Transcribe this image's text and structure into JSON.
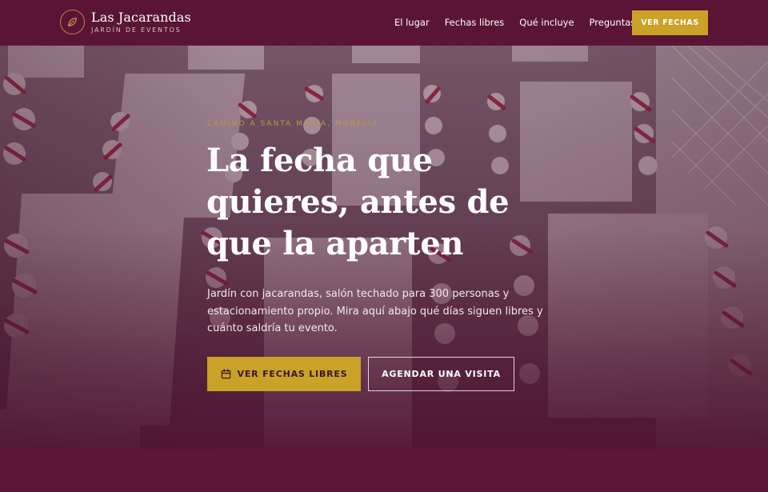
{
  "brand": {
    "name": "Las Jacarandas",
    "tagline": "JARDÍN DE EVENTOS",
    "logo_icon": "leaf-icon"
  },
  "nav": {
    "items": [
      {
        "label": "El lugar"
      },
      {
        "label": "Fechas libres"
      },
      {
        "label": "Qué incluye"
      },
      {
        "label": "Preguntas"
      }
    ],
    "cta_label": "VER FECHAS"
  },
  "hero": {
    "eyebrow": "CAMINO A SANTA MARÍA, MORELIA",
    "headline": "La fecha que quieres, antes de que la aparten",
    "lede": "Jardín con jacarandas, salón techado para 300 personas y estacionamiento propio. Mira aquí abajo qué días siguen libres y cuánto saldría tu evento.",
    "primary_cta": "VER FECHAS LIBRES",
    "primary_cta_icon": "calendar-icon",
    "secondary_cta": "AGENDAR UNA VISITA",
    "photo": "event-tables-photo"
  },
  "colors": {
    "brand_wine": "#5a1436",
    "accent_gold": "#c9a227",
    "text_white": "#ffffff"
  }
}
